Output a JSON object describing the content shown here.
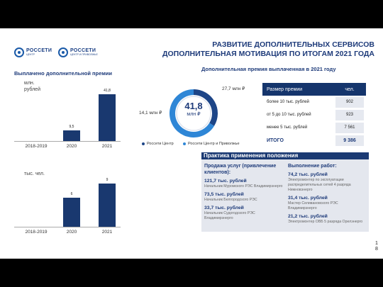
{
  "header": {
    "logo1": {
      "name": "РОССЕТИ",
      "sub": "ЦЕНТР"
    },
    "logo2": {
      "name": "РОССЕТИ",
      "sub": "ЦЕНТР И ПРИВОЛЖЬЕ"
    },
    "title_line1": "РАЗВИТИЕ ДОПОЛНИТЕЛЬНЫХ СЕРВИСОВ",
    "title_line2": "ДОПОЛНИТЕЛЬНАЯ МОТИВАЦИЯ ПО ИТОГАМ 2021 ГОДА"
  },
  "left": {
    "title": "Выплачено дополнительной премии"
  },
  "chart_data": [
    {
      "type": "bar",
      "ylabel": "млн. рублей",
      "categories": [
        "2018-2019",
        "2020",
        "2021"
      ],
      "values": [
        0,
        9.5,
        41.8
      ],
      "value_labels": [
        "",
        "9,5",
        "41,8"
      ],
      "ylim": [
        0,
        50
      ]
    },
    {
      "type": "bar",
      "ylabel": "тыс. чел.",
      "categories": [
        "2018-2019",
        "2020",
        "2021"
      ],
      "values": [
        0,
        6,
        9
      ],
      "value_labels": [
        "",
        "6",
        "9"
      ],
      "ylim": [
        0,
        10.8
      ]
    },
    {
      "type": "pie",
      "title": "Дополнительная премия выплаченная в 2021 году",
      "center_value": "41,8",
      "center_unit": "млн ₽",
      "series": [
        {
          "name": "Россети Центр",
          "value": 14.1,
          "label": "14,1 млн ₽",
          "color": "#1d4587"
        },
        {
          "name": "Россети Центр и Приволжье",
          "value": 27.7,
          "label": "27,7 млн ₽",
          "color": "#2e86d6"
        }
      ]
    }
  ],
  "table": {
    "head": {
      "col1": "Размер премии",
      "col2": "чел."
    },
    "rows": [
      {
        "col1": "более 10 тыс. рублей",
        "col2": "902"
      },
      {
        "col1": "от 5 до 10 тыс. рублей",
        "col2": "923"
      },
      {
        "col1": "менее 5 тыс. рублей",
        "col2": "7 561"
      }
    ],
    "total": {
      "col1": "ИТОГО",
      "col2": "9 386"
    }
  },
  "practice": {
    "title": "Практика применения положения",
    "left": {
      "heading": "Продажа услуг (привлечение клиентов):",
      "items": [
        {
          "amount": "121,7 тыс. рублей",
          "who": "Начальник Муромского РЭС Владимирэнерго"
        },
        {
          "amount": "73,5 тыс. рублей",
          "who": "Начальник Белгородского РЭС"
        },
        {
          "amount": "33,7 тыс. рублей",
          "who": "Начальник Судогодского РЭС Владимирэнерго"
        }
      ]
    },
    "right": {
      "heading": "Выполнение работ:",
      "items": [
        {
          "amount": "74,2 тыс. рублей",
          "who": "Электромонтер по эксплуатации распределительных сетей 4 разряда Нижновэнерго"
        },
        {
          "amount": "31,4 тыс. рублей",
          "who": "Мастер Селивановского РЭС Владимирэнерго"
        },
        {
          "amount": "21,2  тыс. рублей",
          "who": "Электромонтер ОВБ 5 разряда Орелэнерго"
        }
      ]
    }
  },
  "page_number": "18"
}
